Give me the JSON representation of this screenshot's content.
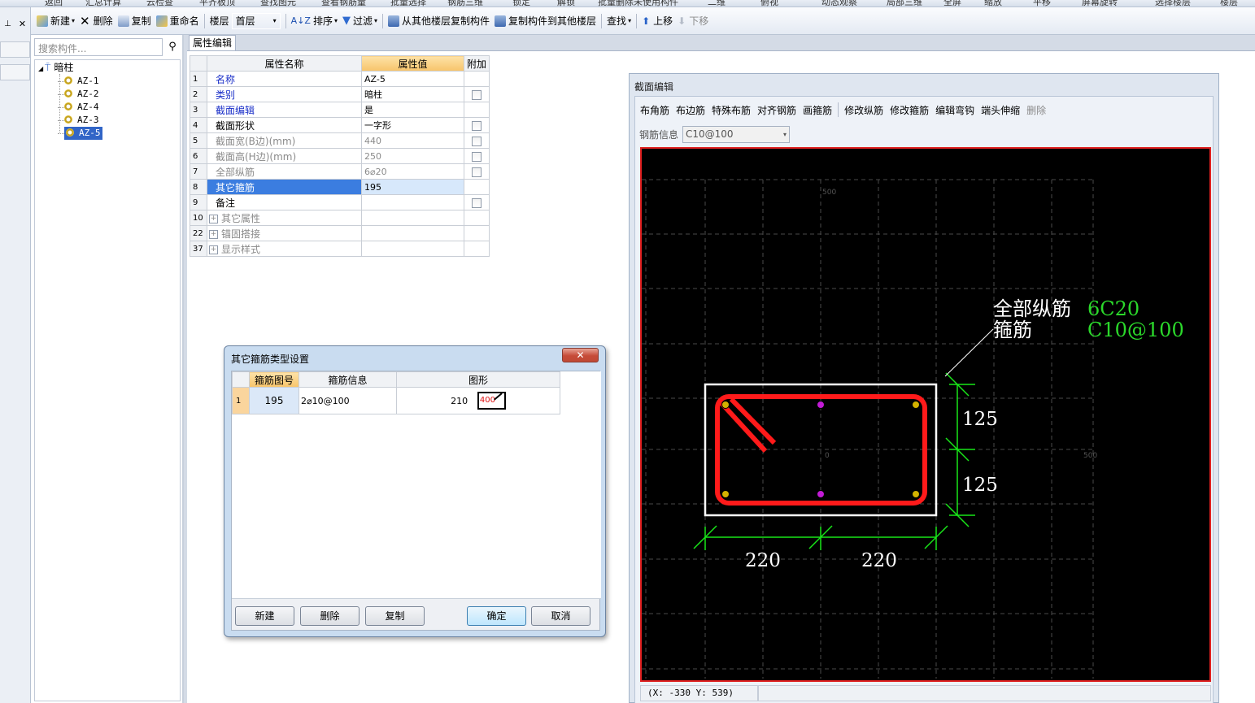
{
  "topstrip": {
    "items": [
      "返回",
      "汇总计算",
      "云检查",
      "平齐板顶",
      "查找图元",
      "查看钢筋量",
      "批量选择",
      "钢筋三维",
      "锁定",
      "解锁",
      "批量删除未使用构件",
      "二维",
      "俯视",
      "动态观察",
      "局部三维",
      "全屏",
      "缩放",
      "平移",
      "屏幕旋转",
      "选择楼层",
      "楼层"
    ]
  },
  "toolbar": {
    "new": "新建",
    "delete": "删除",
    "copy": "复制",
    "rename": "重命名",
    "floor_label": "楼层",
    "floor_value": "首层",
    "sort": "排序",
    "filter": "过滤",
    "copy_from": "从其他楼层复制构件",
    "copy_to": "复制构件到其他楼层",
    "find": "查找",
    "move_up": "上移",
    "move_down": "下移"
  },
  "tree": {
    "search_placeholder": "搜索构件...",
    "root": "暗柱",
    "items": [
      "AZ-1",
      "AZ-2",
      "AZ-4",
      "AZ-3",
      "AZ-5"
    ],
    "selected": "AZ-5"
  },
  "props": {
    "tab": "属性编辑",
    "headers": [
      "属性名称",
      "属性值",
      "附加"
    ],
    "rows": [
      {
        "n": "1",
        "name": "名称",
        "value": "AZ-5",
        "style": "blue",
        "check": false
      },
      {
        "n": "2",
        "name": "类别",
        "value": "暗柱",
        "style": "blue",
        "check": true
      },
      {
        "n": "3",
        "name": "截面编辑",
        "value": "是",
        "style": "blue",
        "check": false
      },
      {
        "n": "4",
        "name": "截面形状",
        "value": "一字形",
        "style": "normal",
        "check": true
      },
      {
        "n": "5",
        "name": "截面宽(B边)(mm)",
        "value": "440",
        "style": "gray",
        "check": true
      },
      {
        "n": "6",
        "name": "截面高(H边)(mm)",
        "value": "250",
        "style": "gray",
        "check": true
      },
      {
        "n": "7",
        "name": "全部纵筋",
        "value": "6⌀20",
        "style": "gray",
        "check": true
      },
      {
        "n": "8",
        "name": "其它箍筋",
        "value": "195",
        "style": "selected",
        "check": false
      },
      {
        "n": "9",
        "name": "备注",
        "value": "",
        "style": "normal",
        "check": true
      },
      {
        "n": "10",
        "name": "其它属性",
        "value": "",
        "style": "group",
        "check": false
      },
      {
        "n": "22",
        "name": "锚固搭接",
        "value": "",
        "style": "group",
        "check": false
      },
      {
        "n": "37",
        "name": "显示样式",
        "value": "",
        "style": "group",
        "check": false
      }
    ]
  },
  "section_editor": {
    "title": "截面编辑",
    "tools": [
      "布角筋",
      "布边筋",
      "特殊布筋",
      "对齐钢筋",
      "画箍筋",
      "修改纵筋",
      "修改箍筋",
      "编辑弯钩",
      "端头伸缩",
      "删除"
    ],
    "rebar_info_label": "钢筋信息",
    "rebar_info_value": "C10@100",
    "status": "(X: -330 Y: 539)",
    "canvas": {
      "label_all": "全部纵筋",
      "label_all_val": "6C20",
      "label_stirrup": "箍筋",
      "label_stirrup_val": "C10@100",
      "dim_h1": "125",
      "dim_h2": "125",
      "dim_w1": "220",
      "dim_w2": "220",
      "axis_top": "500",
      "axis_origin": "0",
      "axis_right": "500",
      "colors": {
        "rebar": "#ff1a1a",
        "dim": "#19e619",
        "outline": "#ffffff",
        "grid": "#4a4a4a",
        "label_val": "#2bd92b"
      }
    }
  },
  "dialog": {
    "title": "其它箍筋类型设置",
    "close": "✕",
    "headers": [
      "箍筋图号",
      "箍筋信息",
      "图形"
    ],
    "row": {
      "n": "1",
      "code": "195",
      "info": "2⌀10@100",
      "shape_left": "210",
      "shape_inner": "400"
    },
    "buttons": [
      "新建",
      "删除",
      "复制",
      "确定",
      "取消"
    ]
  }
}
